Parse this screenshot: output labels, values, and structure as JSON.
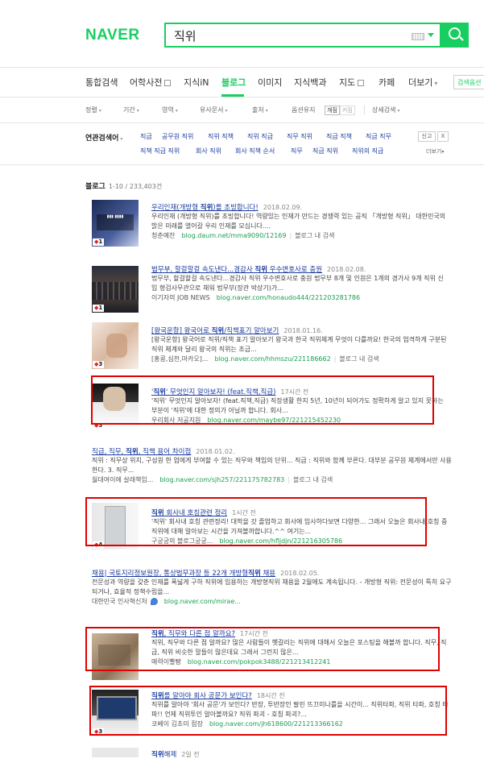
{
  "header": {
    "logo": "NAVER",
    "search": {
      "value": "직위"
    }
  },
  "tabs": [
    {
      "label": "통합검색"
    },
    {
      "label": "어학사전"
    },
    {
      "label": "지식iN"
    },
    {
      "label": "블로그"
    },
    {
      "label": "이미지"
    },
    {
      "label": "지식백과"
    },
    {
      "label": "지도"
    },
    {
      "label": "카페"
    },
    {
      "label": "더보기"
    }
  ],
  "options_button": "검색옵션",
  "filters": {
    "sort": "정렬",
    "period": "기간",
    "area": "영역",
    "similar": "유사문서",
    "source": "출처",
    "option_keep": "옵션유지",
    "on": "개짐",
    "off": "커짐",
    "detail": "상세검색"
  },
  "related": {
    "title": "연관검색어",
    "row1": [
      "직급",
      "공무원 직위",
      "직위 직책",
      "직위 직급",
      "직무 직위",
      "직급 직책",
      "직급 직무"
    ],
    "row2": [
      "직책 직급 직위",
      "회사 직위",
      "회사 직책 순서",
      "직무",
      "직급 직위",
      "직위의 직급"
    ],
    "report": "신고",
    "close": "X",
    "more": "더보기"
  },
  "section": {
    "title": "블로그",
    "count": "1-10 / 233,403건"
  },
  "results": [
    {
      "title_pre": "우리인재(개방형 ",
      "title_bold": "직위",
      "title_post": ")를 초빙합니다!",
      "date": "2018.02.09.",
      "desc": "우리인재 (개방형 직위)를 초빙합니다! 역량있는 인재가 만드는 경쟁력 있는 공직 「개방형 직위」 대한민국의 밝은 미래를 열어갈 우리 인재를 모십니다....",
      "author": "청춘예찬",
      "url": "blog.daum.net/mma9090/12169",
      "inner": "블로그 내 검색",
      "badge": "1"
    },
    {
      "title_pre": "법무부, 할걸할걸 속도낸다...경감사 ",
      "title_bold": "직위",
      "title_post": " 우수변호사로 충원",
      "date": "2018.02.08.",
      "desc": "법무부, 할걸할걸 속도낸다...경감사 직위 우수변호사로 충원 법무부 8개 및 인원은 1개의 경가사 9개 직위 신임 형검사무관으로 채워 법무부(장관 박상기)가...",
      "author": "이기자의 JOB NEWS",
      "url": "blog.naver.com/honaudo444/221203281786",
      "inner": "",
      "badge": "1"
    },
    {
      "title_pre": "[왕국운항] 왕국어로 ",
      "title_bold": "직위",
      "title_post": "/직책표기 알아보기",
      "date": "2018.01.16.",
      "desc": "[왕국운항] 왕국어로 직위/직책 표기 알아보기 왕국과 한국 직위체계 무엇이 다를까요! 한국의 업격하게 구분된 직위 체계와 달리 왕국의 직위는 조금...",
      "author": "[홍콩,심천,마카오]...",
      "url": "blog.naver.com/hhmszu/221186662",
      "inner": "블로그 내 검색",
      "badge": "3"
    },
    {
      "title_pre": "'",
      "title_bold": "직위",
      "title_post": "' 무엇인지 알아보자! (feat.직책,직급)",
      "date": "17시간 전",
      "desc": "'직위' 무엇인지 알아보자! (feat.직책,직급) 직장생활 한지 5년, 10년이 되어가도 정확하게 알고 있지 못하는 부분이 '직위'에 대한 정의가 아닐까 합니다. 회사...",
      "author": "우리회사 저공지원",
      "url": "blog.naver.com/maybe97/221215452230",
      "inner": "",
      "badge": "3"
    },
    {
      "title_pre": "직급, 직무, ",
      "title_bold": "직위",
      "title_post": ", 직책 용어 차이점",
      "date": "2018.01.02.",
      "desc": "직위 : 직무상 위치, 구성원 한 업에게 부여할 수 있는 직무와 책임의 단위... 직급 : 직위와 함께 부른다. 대부분 공무원 체계에서만 사용한다. 3. 직무...",
      "author": "월대여이에 살래책임...",
      "url": "blog.naver.com/sjh257/221175782783",
      "inner": "블로그 내 검색",
      "badge": ""
    },
    {
      "title_pre": "",
      "title_bold": "직위",
      "title_post": " 회사내 호칭관련 정리",
      "date": "1시간 전",
      "desc": "'직위' 회사내 호칭 관련정리! 대학을 갓 졸업하고 회사에 입사하다보면 다양한... 그래서 오늘은 회사내 호칭 중 직위에 대해 알아보는 시간을 가져볼까합니다.^^ 여기는...",
      "author": "구궁궁의 블로그궁궁...",
      "url": "blog.naver.com/hfljdjn/221216305786",
      "inner": "",
      "badge": "4"
    },
    {
      "title_pre": "채용| 국토지리정보원장, 통상법무과장 등 22개 개방형",
      "title_bold": "직위",
      "title_post": " 채용",
      "date": "2018.02.05.",
      "desc": "전문성과 역량을 갖춘 인재를 폭넓게 구하 직위에 임용하는 개방형직위 채용을 2월에도 계속됩니다. - 개방형 직위: 전문성이 특히 요구되거나, 효율적 정책수립을...",
      "author": "대한민국 인사혁신처",
      "url": "blog.naver.com/mirae...",
      "inner": "",
      "badge": ""
    },
    {
      "title_pre": "",
      "title_bold": "직위",
      "title_post": ", 직무와 다른 점 알까요?",
      "date": "17시간 전",
      "desc": "직위, 직무와 다른 점 알까요? 많은 사람들이 헷갈리는 직위에 대해서 오늘은 포스팅을 해볼까 합니다. 직무, 직급, 직위 비슷한 말들이 많은데요 그래서 그런지 많은...",
      "author": "매력이빨빵",
      "url": "blog.naver.com/pokpok3488/221213412241",
      "inner": "",
      "badge": ""
    },
    {
      "title_pre": "",
      "title_bold": "직위",
      "title_post": "를 알아야 회사 공문가 보인다?",
      "date": "18시간 전",
      "desc": "직위를 알아야 '회사 공문'가 보인다? 반장, 투반장인 팔린 뜨끄미나를을 시간이... 직위타파, 직위 타파, 호칭 타파!! 언제 직위투인 알아볼까요? 직위 파괴 - 호칭 파괴?...",
      "author": "코베이 김초미 점장",
      "url": "blog.naver.com/jh618600/221213366162",
      "inner": "",
      "badge": "3"
    },
    {
      "title_pre": "",
      "title_bold": "직위",
      "title_post": "해제",
      "date": "2일 전",
      "desc": "",
      "author": "",
      "url": "",
      "inner": "",
      "badge": ""
    }
  ]
}
